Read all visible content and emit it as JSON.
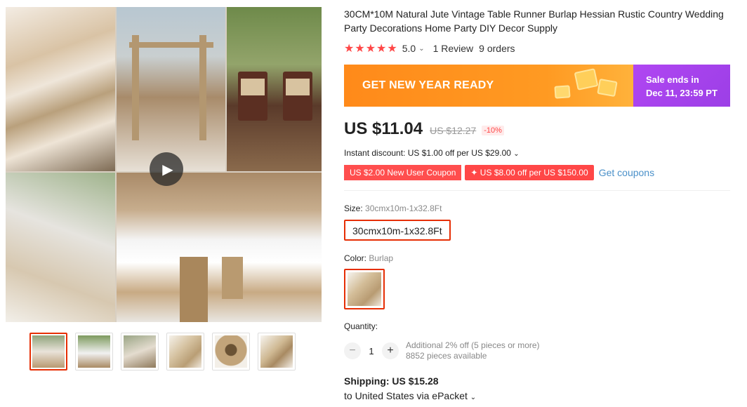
{
  "product": {
    "title": "30CM*10M Natural Jute Vintage Table Runner Burlap Hessian Rustic Country Wedding Party Decorations Home Party DIY Decor Supply",
    "rating_score": "5.0",
    "stars": "★★★★★",
    "reviews": "1 Review",
    "orders": "9 orders"
  },
  "banner": {
    "promo": "GET NEW YEAR READY",
    "sale_line1": "Sale ends in",
    "sale_line2": "Dec 11, 23:59 PT"
  },
  "price": {
    "current": "US $11.04",
    "original": "US $12.27",
    "discount": "-10%"
  },
  "instant_discount": "Instant discount: US $1.00 off per US $29.00",
  "coupons": {
    "new_user": "US $2.00 New User Coupon",
    "store": "✦ US $8.00 off per US $150.00",
    "get_label": "Get coupons"
  },
  "size": {
    "label": "Size:",
    "selected": "30cmx10m-1x32.8Ft",
    "option": "30cmx10m-1x32.8Ft"
  },
  "color": {
    "label": "Color:",
    "selected": "Burlap"
  },
  "quantity": {
    "label": "Quantity:",
    "value": "1",
    "minus": "−",
    "plus": "+",
    "note1": "Additional 2% off (5 pieces or more)",
    "note2": "8852 pieces available"
  },
  "shipping": {
    "cost": "Shipping: US $15.28",
    "destination": "to United States via ePacket"
  },
  "icons": {
    "play": "▶",
    "caret": "⌄"
  },
  "colors": {
    "accent": "#e62e04",
    "coupon": "#ff4747",
    "banner_orange": "#ff8a1a",
    "banner_purple": "#a946ef",
    "link": "#4a90c9"
  }
}
